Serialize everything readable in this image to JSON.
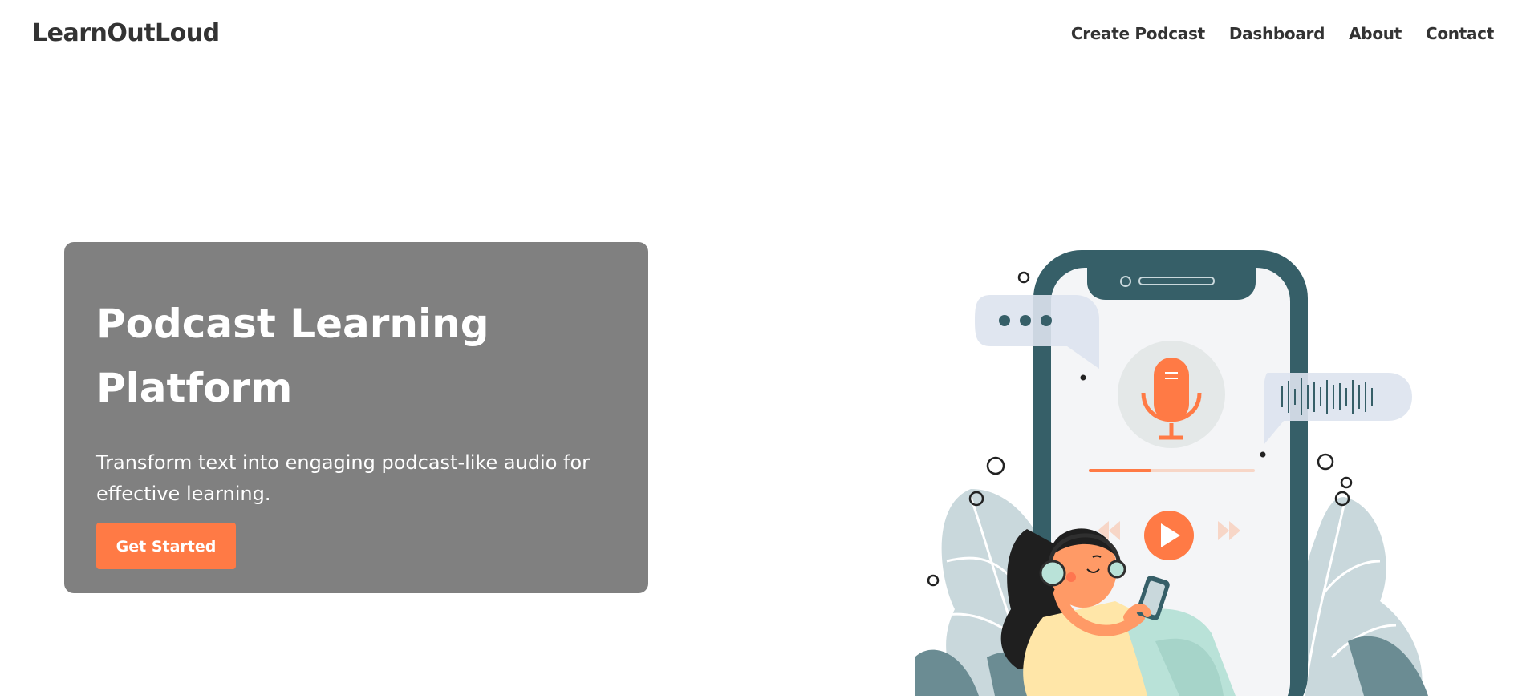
{
  "header": {
    "logo_text": "LearnOutLoud",
    "nav": [
      {
        "label": "Create Podcast"
      },
      {
        "label": "Dashboard"
      },
      {
        "label": "About"
      },
      {
        "label": "Contact"
      }
    ]
  },
  "hero": {
    "title": "Podcast Learning Platform",
    "subtitle": "Transform text into engaging podcast-like audio for effective learning.",
    "cta_label": "Get Started"
  },
  "illustration": {
    "name": "person-listening-podcast-on-phone",
    "colors": {
      "primary_dark": "#365f68",
      "accent": "#ff7a45",
      "leaf": "#c9d8dc",
      "bubble": "#dde3ee",
      "screen": "#f4f5f7"
    }
  },
  "colors": {
    "card_bg": "#808080",
    "button_bg": "#ff7a45",
    "text_dark": "#333333"
  }
}
